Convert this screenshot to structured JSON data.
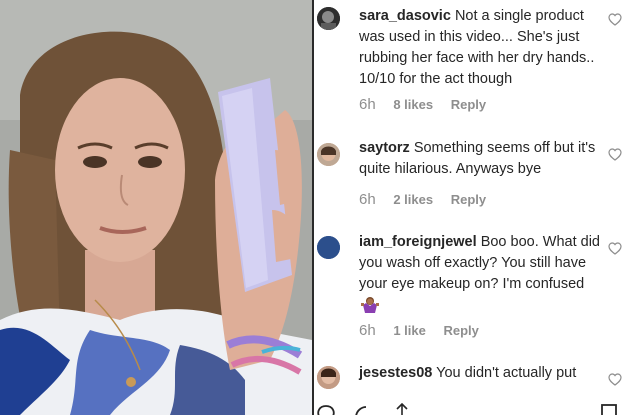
{
  "comments": [
    {
      "username": "sara_dasovic",
      "text": "Not a single product was used in this video... She's just rubbing her face with her dry hands.. 10/10 for the act though",
      "time": "6h",
      "likes": "8 likes",
      "reply": "Reply"
    },
    {
      "username": "saytorz",
      "text": "Something seems off but it's quite hilarious. Anyways bye",
      "time": "6h",
      "likes": "2 likes",
      "reply": "Reply"
    },
    {
      "username": "iam_foreignjewel",
      "text": "Boo boo. What did you wash off exactly? You still have your eye makeup on? I'm confused",
      "time": "6h",
      "likes": "1 like",
      "reply": "Reply"
    },
    {
      "username": "jesestes08",
      "text": "You didn't actually put",
      "time": "",
      "likes": "",
      "reply": ""
    }
  ],
  "icons": {
    "heart": "heart-icon",
    "comment": "comment-icon",
    "share": "share-icon",
    "save": "bookmark-icon",
    "emoji": "woman-shrugging-emoji"
  },
  "colors": {
    "meta_text": "#8e8e8e",
    "body_text": "#262626",
    "tube": "#c7c3ec"
  }
}
